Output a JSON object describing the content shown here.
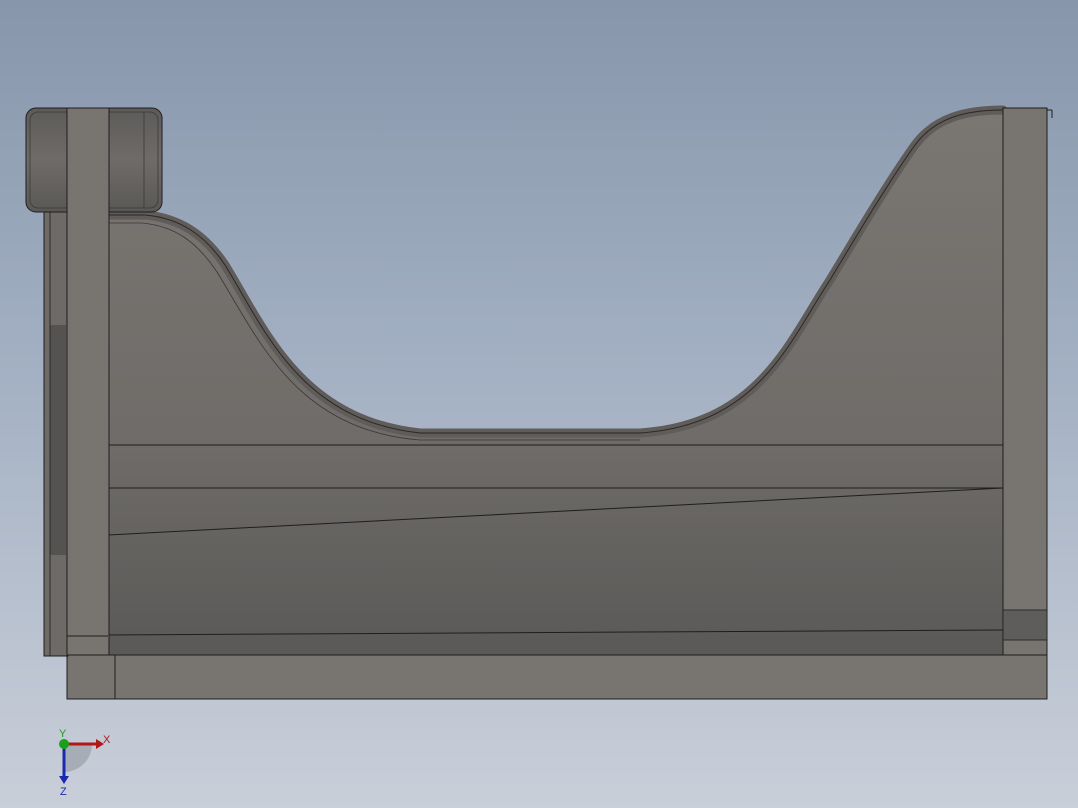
{
  "viewport": {
    "background_top": "#8796ab",
    "background_bottom": "#c9cfd9"
  },
  "model": {
    "body_color": "#787470",
    "shadow_color": "#5e5c5a",
    "edge_color": "#1e1e1e",
    "rim_color": "#6a6764"
  },
  "triad": {
    "x_label": "X",
    "y_label": "Y",
    "z_label": "Z",
    "x_color": "#b01818",
    "y_color": "#1aa01a",
    "z_color": "#1a2ab0"
  }
}
